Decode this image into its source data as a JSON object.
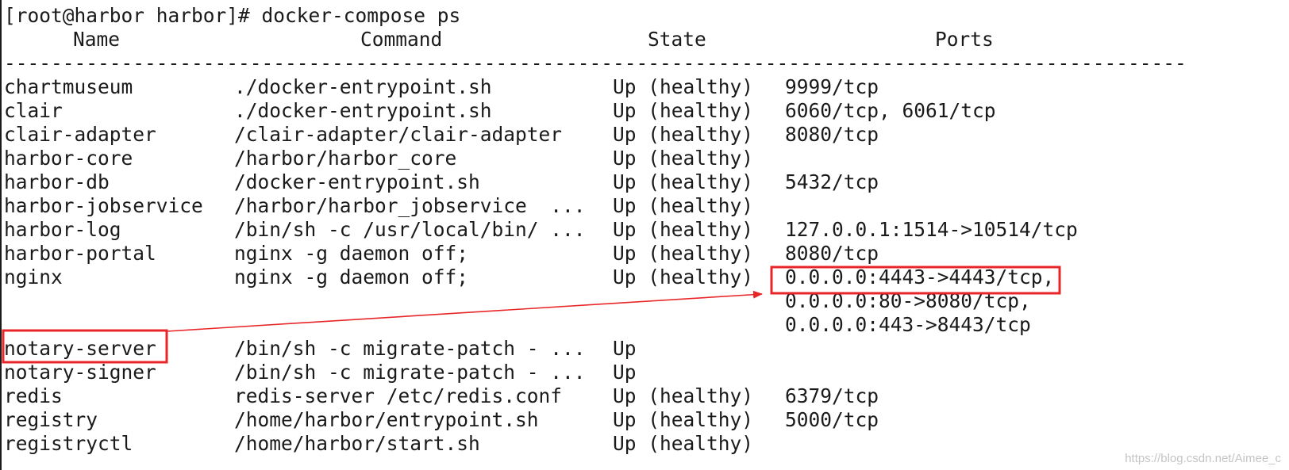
{
  "terminal": {
    "prompt_line": "[root@harbor harbor]# docker-compose ps",
    "headers": {
      "name": "Name",
      "command": "Command",
      "state": "State",
      "ports": "Ports"
    },
    "separator": "-----------------------------------------------------------------------------------------------------",
    "rows": [
      {
        "name": "chartmuseum",
        "command": "./docker-entrypoint.sh",
        "state": "Up (healthy)",
        "ports": "9999/tcp"
      },
      {
        "name": "clair",
        "command": "./docker-entrypoint.sh",
        "state": "Up (healthy)",
        "ports": "6060/tcp, 6061/tcp"
      },
      {
        "name": "clair-adapter",
        "command": "/clair-adapter/clair-adapter",
        "state": "Up (healthy)",
        "ports": "8080/tcp"
      },
      {
        "name": "harbor-core",
        "command": "/harbor/harbor_core",
        "state": "Up (healthy)",
        "ports": ""
      },
      {
        "name": "harbor-db",
        "command": "/docker-entrypoint.sh",
        "state": "Up (healthy)",
        "ports": "5432/tcp"
      },
      {
        "name": "harbor-jobservice",
        "command": "/harbor/harbor_jobservice  ...",
        "state": "Up (healthy)",
        "ports": ""
      },
      {
        "name": "harbor-log",
        "command": "/bin/sh -c /usr/local/bin/ ...",
        "state": "Up (healthy)",
        "ports": "127.0.0.1:1514->10514/tcp"
      },
      {
        "name": "harbor-portal",
        "command": "nginx -g daemon off;",
        "state": "Up (healthy)",
        "ports": "8080/tcp"
      },
      {
        "name": "nginx",
        "command": "nginx -g daemon off;",
        "state": "Up (healthy)",
        "ports": "0.0.0.0:4443->4443/tcp,"
      },
      {
        "name": "",
        "command": "",
        "state": "",
        "ports": "0.0.0.0:80->8080/tcp,"
      },
      {
        "name": "",
        "command": "",
        "state": "",
        "ports": "0.0.0.0:443->8443/tcp"
      },
      {
        "name": "notary-server",
        "command": "/bin/sh -c migrate-patch - ...",
        "state": "Up",
        "ports": ""
      },
      {
        "name": "notary-signer",
        "command": "/bin/sh -c migrate-patch - ...",
        "state": "Up",
        "ports": ""
      },
      {
        "name": "redis",
        "command": "redis-server /etc/redis.conf",
        "state": "Up (healthy)",
        "ports": "6379/tcp"
      },
      {
        "name": "registry",
        "command": "/home/harbor/entrypoint.sh",
        "state": "Up (healthy)",
        "ports": "5000/tcp"
      },
      {
        "name": "registryctl",
        "command": "/home/harbor/start.sh",
        "state": "Up (healthy)",
        "ports": ""
      }
    ]
  },
  "annotations": {
    "color": "#e8262a"
  },
  "watermark": "https://blog.csdn.net/Aimee_c"
}
